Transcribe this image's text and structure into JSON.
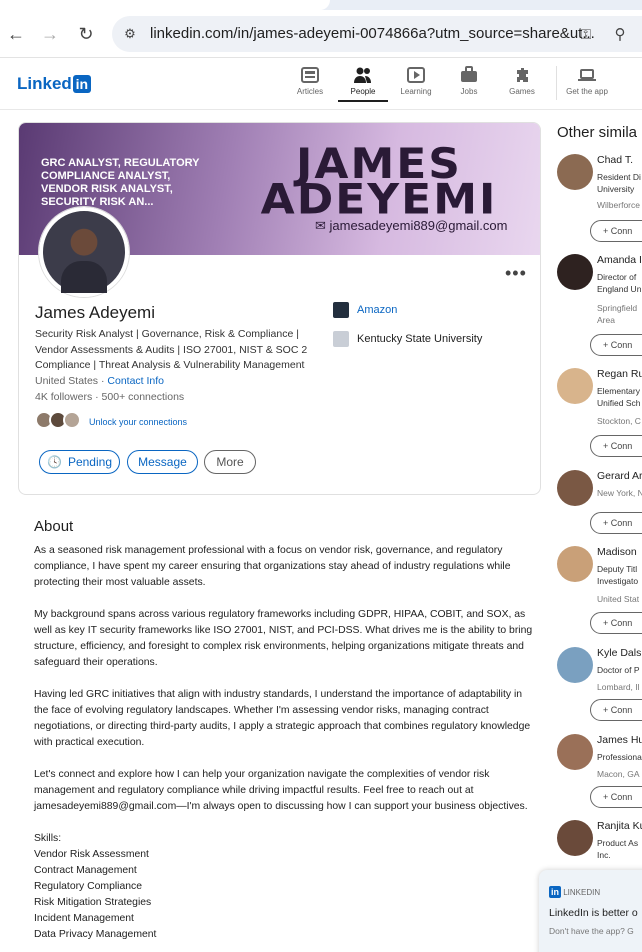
{
  "browser": {
    "url": "linkedin.com/in/james-adeyemi-0074866a?utm_source=share&ut..."
  },
  "linkedin": {
    "logo_text": "Linked",
    "logo_in": "in",
    "nav": [
      {
        "label": "Articles",
        "icon": "articles-icon"
      },
      {
        "label": "People",
        "icon": "people-icon"
      },
      {
        "label": "Learning",
        "icon": "learning-icon"
      },
      {
        "label": "Jobs",
        "icon": "jobs-icon"
      },
      {
        "label": "Games",
        "icon": "games-icon"
      },
      {
        "label": "Get the app",
        "icon": "laptop-icon"
      }
    ]
  },
  "profile": {
    "banner_title": "GRC ANALYST, REGULATORY COMPLIANCE ANALYST, VENDOR RISK ANALYST, SECURITY RISK AN...",
    "banner_name_line1": "JAMES",
    "banner_name_line2": "ADEYEMI",
    "banner_email": "jamesadeyemi889@gmail.com",
    "name": "James Adeyemi",
    "headline": "Security Risk Analyst | Governance, Risk & Compliance | Vendor Assessments & Audits | ISO 27001, NIST & SOC 2 Compliance | Threat Analysis & Vulnerability Management",
    "location": "United States",
    "contact_info": "Contact Info",
    "followers": "4K followers",
    "connections": "500+ connections",
    "unlock": "Unlock your connections",
    "buttons": {
      "pending": "Pending",
      "message": "Message",
      "more": "More"
    },
    "experience": [
      {
        "name": "Amazon",
        "color": "#232f3e"
      },
      {
        "name": "Kentucky State University",
        "color": "#c9ced6"
      }
    ]
  },
  "about": {
    "heading": "About",
    "p1": "As a seasoned risk management professional with a focus on vendor risk, governance, and regulatory compliance, I have spent my career ensuring that organizations stay ahead of industry regulations while protecting their most valuable assets.",
    "p2": "My background spans across various regulatory frameworks including GDPR, HIPAA, COBIT, and SOX, as well as key IT security frameworks like ISO 27001, NIST, and PCI-DSS. What drives me is the ability to bring structure, efficiency, and foresight to complex risk environments, helping organizations mitigate threats and safeguard their operations.",
    "p3": "Having led GRC initiatives that align with industry standards, I understand the importance of adaptability in the face of evolving regulatory landscapes. Whether I'm assessing vendor risks, managing contract negotiations, or directing third-party audits, I apply a strategic approach that combines regulatory knowledge with practical execution.",
    "p4": "Let's connect and explore how I can help your organization navigate the complexities of vendor risk management and regulatory compliance while driving impactful results. Feel free to reach out at jamesadeyemi889@gmail.com—I'm always open to discussing how I can support your business objectives.",
    "skills_label": "Skills:",
    "skills": [
      "Vendor Risk Assessment",
      "Contract Management",
      "Regulatory Compliance",
      "Risk Mitigation Strategies",
      "Incident Management",
      "Data Privacy Management"
    ]
  },
  "sidebar": {
    "heading": "Other simila",
    "connect": "Conn",
    "people": [
      {
        "name": "Chad T.",
        "title1": "Resident Di",
        "title2": "University",
        "location": "Wilberforce"
      },
      {
        "name": "Amanda I",
        "title1": "Director of",
        "title2": "England Un",
        "location": "Springfield",
        "location2": "Area"
      },
      {
        "name": "Regan Ru",
        "title1": "Elementary",
        "title2": "Unified Sch",
        "location": "Stockton, C"
      },
      {
        "name": "Gerard Ar",
        "title1": "New York, N",
        "title2": "",
        "location": ""
      },
      {
        "name": "Madison",
        "title1": "Deputy Titl",
        "title2": "Investigato",
        "location": "United Stat"
      },
      {
        "name": "Kyle Dalsl",
        "title1": "Doctor of P",
        "title2": "",
        "location": "Lombard, Il"
      },
      {
        "name": "James Hu",
        "title1": "Professiona",
        "title2": "",
        "location": "Macon, GA"
      },
      {
        "name": "Ranjita Ku",
        "title1": "Product As",
        "title2": "Inc.",
        "location": ""
      }
    ]
  },
  "toast": {
    "brand": "LINKEDIN",
    "title": "LinkedIn is better o",
    "subtitle": "Don't have the app? G"
  }
}
